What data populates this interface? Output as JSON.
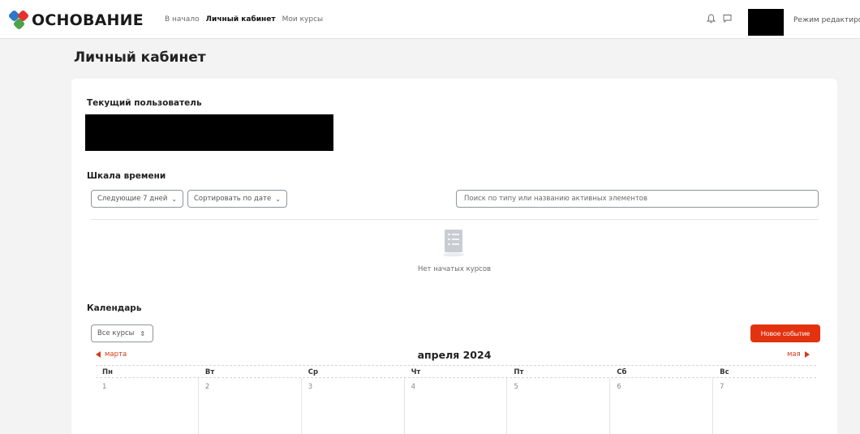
{
  "header": {
    "logo_text": "ОСНОВАНИЕ",
    "nav": [
      {
        "label": "В начало",
        "active": false
      },
      {
        "label": "Личный кабинет",
        "active": true
      },
      {
        "label": "Мои курсы",
        "active": false
      }
    ],
    "edit_mode_label": "Режим редактиро",
    "icons": [
      "bell-icon",
      "chat-icon"
    ]
  },
  "page": {
    "title": "Личный кабинет"
  },
  "current_user": {
    "title": "Текущий пользователь"
  },
  "timeline": {
    "title": "Шкала времени",
    "range_select": "Следующие 7 дней",
    "sort_select": "Сортировать по дате",
    "search_placeholder": "Поиск по типу или названию активных элементов",
    "empty_text": "Нет начатых курсов"
  },
  "calendar": {
    "title": "Календарь",
    "course_select": "Все курсы",
    "new_event_label": "Новое событие",
    "prev_month": "марта",
    "current_month": "апреля 2024",
    "next_month": "мая",
    "weekdays": [
      "Пн",
      "Вт",
      "Ср",
      "Чт",
      "Пт",
      "Сб",
      "Вс"
    ],
    "days": [
      "1",
      "2",
      "3",
      "4",
      "5",
      "6",
      "7"
    ]
  },
  "colors": {
    "accent": "#e3320f",
    "link": "#d23a1a"
  }
}
